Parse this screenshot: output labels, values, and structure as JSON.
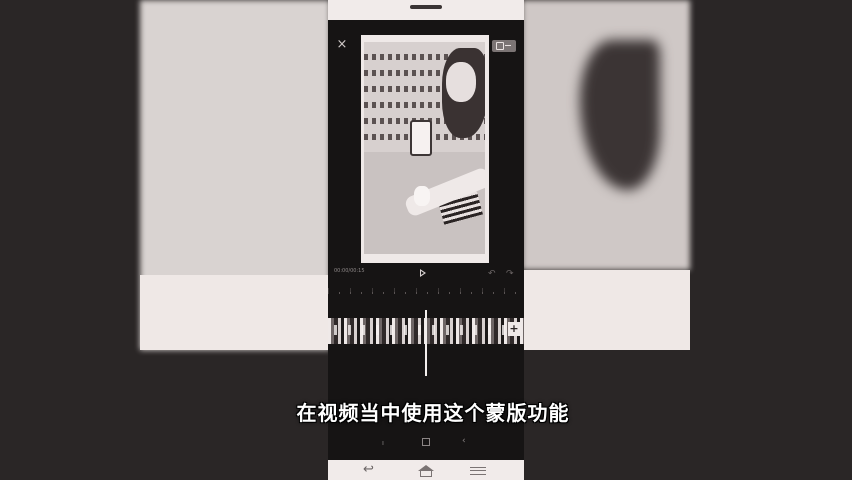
{
  "editor": {
    "close_icon": "×",
    "time_label": "00:00/00:15",
    "undo_icon": "↶",
    "redo_icon": "↷",
    "add_clip_icon": "+"
  },
  "subtitle": {
    "text": "在视频当中使用这个蒙版功能"
  },
  "toolbar": {
    "tool1_icon": "ı",
    "tool3_icon": "‹"
  },
  "navigation": {
    "back_icon": "↩"
  },
  "colors": {
    "phone_bg": "#f1ebea",
    "app_bg": "#161414",
    "caption_text": "#ffffff"
  }
}
